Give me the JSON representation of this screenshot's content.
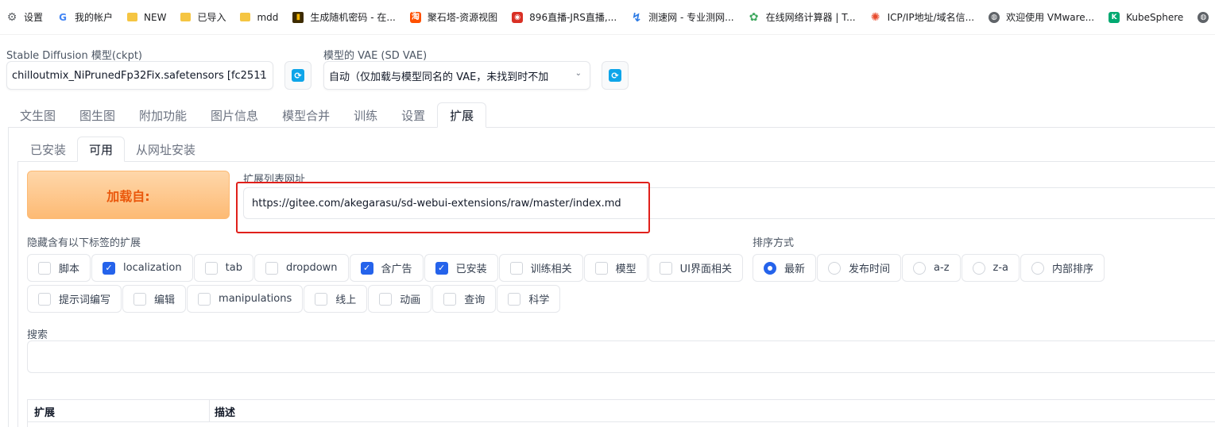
{
  "bookmarks": [
    {
      "label": "设置",
      "icon": "gear-icon"
    },
    {
      "label": "我的帐户",
      "icon": "google-icon"
    },
    {
      "label": "NEW",
      "icon": "folder-icon"
    },
    {
      "label": "已导入",
      "icon": "folder-icon"
    },
    {
      "label": "mdd",
      "icon": "folder-icon"
    },
    {
      "label": "生成随机密码 - 在...",
      "icon": "key-icon"
    },
    {
      "label": "聚石塔-资源视图",
      "icon": "taobao-icon"
    },
    {
      "label": "896直播-JRS直播,...",
      "icon": "tv-icon"
    },
    {
      "label": "测速网 - 专业测网...",
      "icon": "speed-icon"
    },
    {
      "label": "在线网络计算器 | T...",
      "icon": "calc-icon"
    },
    {
      "label": "ICP/IP地址/域名信...",
      "icon": "icp-icon"
    },
    {
      "label": "欢迎使用 VMware...",
      "icon": "globe-icon"
    },
    {
      "label": "KubeSphere",
      "icon": "kubesphere-icon"
    },
    {
      "label": "",
      "icon": "globe-icon"
    }
  ],
  "sd_model": {
    "label": "Stable Diffusion 模型(ckpt)",
    "value": "chilloutmix_NiPrunedFp32Fix.safetensors [fc2511"
  },
  "sd_vae": {
    "label": "模型的 VAE (SD VAE)",
    "value": "自动（仅加载与模型同名的 VAE，未找到时不加"
  },
  "main_tabs": [
    "文生图",
    "图生图",
    "附加功能",
    "图片信息",
    "模型合并",
    "训练",
    "设置",
    "扩展"
  ],
  "main_tab_active": "扩展",
  "sub_tabs": [
    "已安装",
    "可用",
    "从网址安装"
  ],
  "sub_tab_active": "可用",
  "load_button": "加载自:",
  "extension_list_url": {
    "label": "扩展列表网址",
    "value": "https://gitee.com/akegarasu/sd-webui-extensions/raw/master/index.md"
  },
  "hide_tags": {
    "label": "隐藏含有以下标签的扩展",
    "row1": [
      {
        "label": "脚本",
        "checked": false
      },
      {
        "label": "localization",
        "checked": true
      },
      {
        "label": "tab",
        "checked": false
      },
      {
        "label": "dropdown",
        "checked": false
      },
      {
        "label": "含广告",
        "checked": true
      },
      {
        "label": "已安装",
        "checked": true
      },
      {
        "label": "训练相关",
        "checked": false
      },
      {
        "label": "模型",
        "checked": false
      },
      {
        "label": "UI界面相关",
        "checked": false
      }
    ],
    "row2": [
      {
        "label": "提示词编写",
        "checked": false
      },
      {
        "label": "编辑",
        "checked": false
      },
      {
        "label": "manipulations",
        "checked": false
      },
      {
        "label": "线上",
        "checked": false
      },
      {
        "label": "动画",
        "checked": false
      },
      {
        "label": "查询",
        "checked": false
      },
      {
        "label": "科学",
        "checked": false
      }
    ]
  },
  "sort": {
    "label": "排序方式",
    "options": [
      {
        "label": "最新",
        "selected": true
      },
      {
        "label": "发布时间",
        "selected": false
      },
      {
        "label": "a-z",
        "selected": false
      },
      {
        "label": "z-a",
        "selected": false
      },
      {
        "label": "内部排序",
        "selected": false
      }
    ]
  },
  "search": {
    "label": "搜索",
    "value": ""
  },
  "table": {
    "headers": [
      "扩展",
      "描述"
    ]
  },
  "colors": {
    "accent": "#2563eb",
    "load_button_text": "#ea580c",
    "highlight": "#e0201b"
  }
}
